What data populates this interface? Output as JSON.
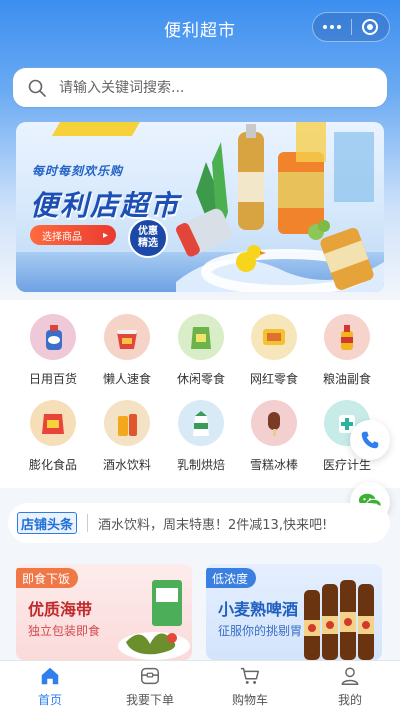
{
  "header": {
    "title": "便利超市"
  },
  "search": {
    "placeholder": "请输入关键词搜索..."
  },
  "banner": {
    "slogan": "每时每刻欢乐购",
    "headline": "便利店超市",
    "button_label": "选择商品",
    "seal_line1": "优惠",
    "seal_line2": "精选"
  },
  "categories": [
    {
      "label": "日用百货",
      "icon": "detergent-icon",
      "color": "#f0c9d9"
    },
    {
      "label": "懒人速食",
      "icon": "instant-noodle-icon",
      "color": "#f6d3c7"
    },
    {
      "label": "休闲零食",
      "icon": "snack-bag-icon",
      "color": "#d8edc8"
    },
    {
      "label": "网红零食",
      "icon": "chips-icon",
      "color": "#f7e6b9"
    },
    {
      "label": "粮油副食",
      "icon": "oil-bottle-icon",
      "color": "#f6d4cc"
    },
    {
      "label": "膨化食品",
      "icon": "puffed-snack-icon",
      "color": "#f6dfb8"
    },
    {
      "label": "酒水饮料",
      "icon": "beverage-icon",
      "color": "#f4e2c4"
    },
    {
      "label": "乳制烘焙",
      "icon": "milk-icon",
      "color": "#d8eaf6"
    },
    {
      "label": "雪糕冰棒",
      "icon": "ice-cream-icon",
      "color": "#f3cfcf"
    },
    {
      "label": "医疗计生",
      "icon": "medicine-icon",
      "color": "#c7ece8"
    }
  ],
  "notice": {
    "tag": "店铺头条",
    "text": "酒水饮料，周末特惠！2件减13,快来吧!"
  },
  "promos": [
    {
      "badge": "即食下饭",
      "name": "优质海带",
      "sub": "独立包装即食"
    },
    {
      "badge": "低浓度",
      "name": "小麦熟啤酒",
      "sub": "征服你的挑剔胃"
    }
  ],
  "tabbar": [
    {
      "label": "首页",
      "icon": "home-icon",
      "active": true
    },
    {
      "label": "我要下单",
      "icon": "order-box-icon",
      "active": false
    },
    {
      "label": "购物车",
      "icon": "cart-icon",
      "active": false
    },
    {
      "label": "我的",
      "icon": "user-icon",
      "active": false
    }
  ],
  "colors": {
    "brand": "#2f80ed",
    "header": "#3c8ff0"
  }
}
